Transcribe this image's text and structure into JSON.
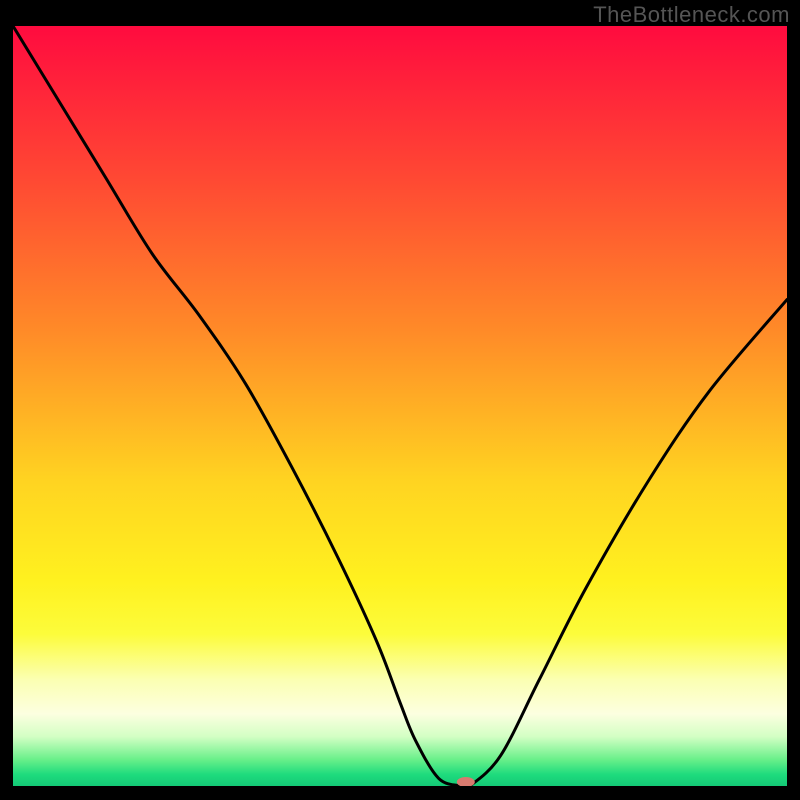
{
  "watermark": "TheBottleneck.com",
  "chart_data": {
    "type": "line",
    "title": "",
    "xlabel": "",
    "ylabel": "",
    "xlim": [
      0,
      100
    ],
    "ylim": [
      0,
      100
    ],
    "gradient_stops": [
      {
        "offset": 0.0,
        "color": "#ff0b3f"
      },
      {
        "offset": 0.2,
        "color": "#ff4833"
      },
      {
        "offset": 0.4,
        "color": "#ff8a28"
      },
      {
        "offset": 0.6,
        "color": "#ffd421"
      },
      {
        "offset": 0.73,
        "color": "#fff11f"
      },
      {
        "offset": 0.8,
        "color": "#fcfc3b"
      },
      {
        "offset": 0.86,
        "color": "#fbffb2"
      },
      {
        "offset": 0.905,
        "color": "#fcffe0"
      },
      {
        "offset": 0.935,
        "color": "#d3ffc4"
      },
      {
        "offset": 0.965,
        "color": "#6af08a"
      },
      {
        "offset": 0.985,
        "color": "#1edb7d"
      },
      {
        "offset": 1.0,
        "color": "#14c976"
      }
    ],
    "series": [
      {
        "name": "bottleneck-curve",
        "x": [
          0,
          6,
          12,
          18,
          24,
          30,
          36,
          42,
          47,
          50,
          52,
          55,
          58,
          59,
          63,
          68,
          74,
          82,
          90,
          100
        ],
        "y": [
          100,
          90,
          80,
          70,
          62,
          53,
          42,
          30,
          19,
          11,
          6,
          1,
          0,
          0,
          4,
          14,
          26,
          40,
          52,
          64
        ]
      }
    ],
    "marker": {
      "x": 58.5,
      "y": 0,
      "color": "#d87a6f",
      "rx": 9,
      "ry": 5
    }
  }
}
